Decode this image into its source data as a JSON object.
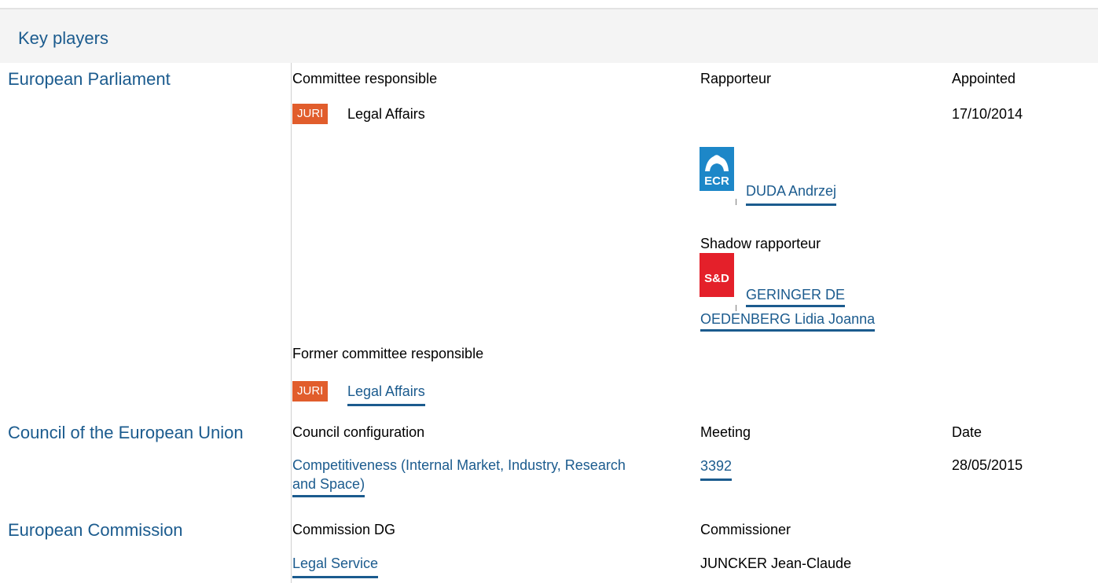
{
  "panel": {
    "title": "Key players"
  },
  "ep": {
    "institution": "European Parliament",
    "col_committee": "Committee responsible",
    "col_rapporteur": "Rapporteur",
    "col_appointed": "Appointed",
    "committee_badge": "JURI",
    "committee_name": "Legal Affairs",
    "appointed_date": "17/10/2014",
    "rapporteur": {
      "group_logo": "ECR",
      "name": "DUDA Andrzej"
    },
    "shadow_label": "Shadow rapporteur",
    "shadow": {
      "group_logo": "S&D",
      "name_line1": "GERINGER DE",
      "name_line2": "OEDENBERG Lidia Joanna"
    },
    "former_label": "Former committee responsible",
    "former_badge": "JURI",
    "former_name": "Legal Affairs"
  },
  "council": {
    "institution": "Council of the European Union",
    "col_config": "Council configuration",
    "col_meeting": "Meeting",
    "col_date": "Date",
    "config_line1": "Competitiveness (Internal Market, Industry, Research",
    "config_line2": "and Space)",
    "meeting": "3392",
    "date": "28/05/2015"
  },
  "commission": {
    "institution": "European Commission",
    "col_dg": "Commission DG",
    "col_commissioner": "Commissioner",
    "dg": "Legal Service",
    "commissioner": "JUNCKER Jean-Claude"
  },
  "colors": {
    "link": "#1b5b8e",
    "badge": "#e15d2c",
    "ecr": "#1d87c8",
    "sd": "#e4202a"
  }
}
